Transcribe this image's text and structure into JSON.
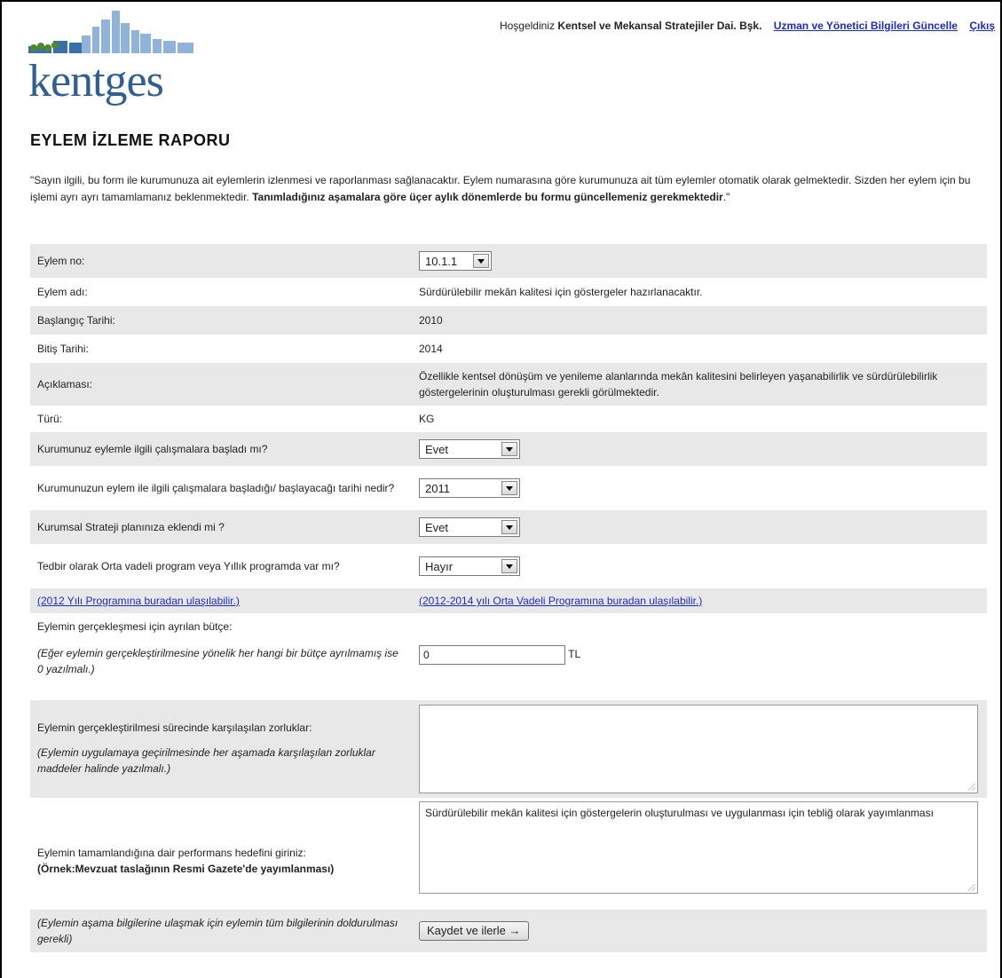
{
  "header": {
    "logo_text": "kentges",
    "welcome_prefix": "Hoşgeldiniz",
    "user_name": "Kentsel ve Mekansal Stratejiler Dai. Bşk.",
    "update_link": "Uzman ve Yönetici Bilgileri Güncelle",
    "logout_link": "Çıkış"
  },
  "page": {
    "title": "EYLEM İZLEME RAPORU",
    "intro_normal": "\"Sayın ilgili, bu form ile kurumunuza ait eylemlerin izlenmesi ve raporlanması sağlanacaktır. Eylem numarasına göre kurumunuza ait tüm eylemler otomatik olarak gelmektedir. Sizden her eylem için bu işlemi ayrı ayrı tamamlamanız beklenmektedir. ",
    "intro_bold": "Tanımladığınız aşamalara göre üçer aylık dönemlerde bu formu güncellemeniz gerekmektedir",
    "intro_end": ".\""
  },
  "form": {
    "eylem_no_label": "Eylem no:",
    "eylem_no_value": "10.1.1",
    "eylem_adi_label": "Eylem adı:",
    "eylem_adi_value": "Sürdürülebilir mekân kalitesi için göstergeler hazırlanacaktır.",
    "baslangic_label": "Başlangıç Tarihi:",
    "baslangic_value": "2010",
    "bitis_label": "Bitiş Tarihi:",
    "bitis_value": "2014",
    "aciklama_label": "Açıklaması:",
    "aciklama_value": "Özellikle kentsel dönüşüm ve yenileme alanlarında mekân kalitesini belirleyen yaşanabilirlik ve sürdürülebilirlik göstergelerinin oluşturulması gerekli görülmektedir.",
    "turu_label": "Türü:",
    "turu_value": "KG",
    "basladi_label": "Kurumunuz eylemle ilgili çalışmalara başladı mı?",
    "basladi_value": "Evet",
    "tarih_label": "Kurumunuzun eylem ile ilgili çalışmalara başladığı/ başlayacağı tarihi nedir?",
    "tarih_value": "2011",
    "strateji_label": "Kurumsal Strateji planınıza eklendi mi ?",
    "strateji_value": "Evet",
    "program_label": "Tedbir olarak Orta vadeli program veya Yıllık programda var mı?",
    "program_value": "Hayır",
    "link_2012": "(2012 Yılı Programına buradan ulaşılabilir.)",
    "link_ovp": "(2012-2014 yılı Orta Vadeli Programına buradan ulaşılabilir.)",
    "butce_label": "Eylemin gerçekleşmesi için ayrılan bütçe:",
    "butce_hint": "(Eğer eylemin gerçekleştirilmesine yönelik her hangi bir bütçe ayrılmamış ise 0 yazılmalı.)",
    "butce_value": "0",
    "butce_unit": "TL",
    "zorluk_label": "Eylemin gerçekleştirilmesi sürecinde karşılaşılan zorluklar:",
    "zorluk_hint": "(Eylemin uygulamaya geçirilmesinde her aşamada karşılaşılan zorluklar maddeler halinde yazılmalı.)",
    "zorluk_value": "",
    "hedef_label": "Eylemin tamamlandığına dair performans hedefini giriniz:",
    "hedef_example": "(Örnek:Mevzuat taslağının Resmi Gazete'de yayımlanması)",
    "hedef_value": "Sürdürülebilir mekân kalitesi için göstergelerin oluşturulması ve uygulanması için tebliğ olarak yayımlanması",
    "footer_hint": "(Eylemin aşama bilgilerine ulaşmak için eylemin tüm bilgilerinin doldurulması gerekli)",
    "submit_label": "Kaydet ve ilerle →"
  }
}
